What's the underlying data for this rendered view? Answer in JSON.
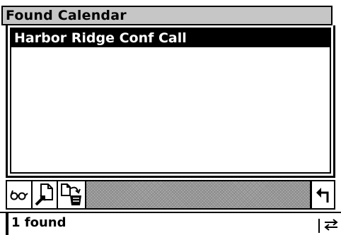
{
  "window": {
    "title": "Found Calendar"
  },
  "results": [
    {
      "label": "Harbor Ridge Conf Call",
      "selected": true
    }
  ],
  "toolbar": {
    "buttons": [
      {
        "icon": "glasses-icon"
      },
      {
        "icon": "goto-document-icon"
      },
      {
        "icon": "copy-to-trash-icon"
      }
    ],
    "back_icon": "return-arrow-icon"
  },
  "status": {
    "text": "1 found",
    "icon": "transfer-arrows-icon"
  }
}
